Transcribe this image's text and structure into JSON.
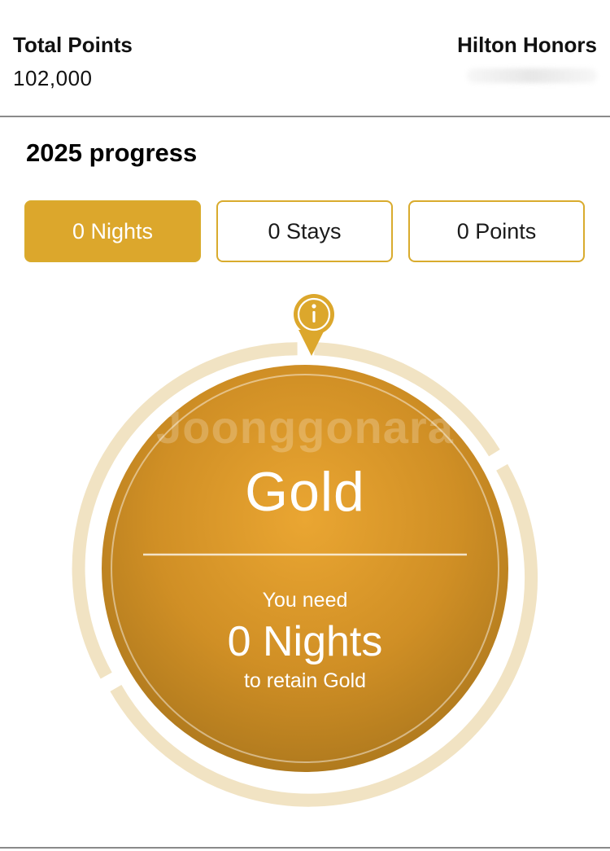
{
  "header": {
    "total_points_label": "Total Points",
    "total_points_value": "102,000",
    "program_name": "Hilton Honors"
  },
  "progress": {
    "title": "2025 progress",
    "tabs": [
      {
        "label": "0 Nights",
        "active": true
      },
      {
        "label": "0 Stays",
        "active": false
      },
      {
        "label": "0 Points",
        "active": false
      }
    ],
    "progress_fraction": 0
  },
  "medal": {
    "tier": "Gold",
    "need_label": "You need",
    "need_value": "0 Nights",
    "retain_label": "to retain Gold",
    "watermark": "Joonggonara"
  },
  "icons": {
    "info_marker": "info-icon"
  },
  "colors": {
    "accent_gold": "#dca72c",
    "ring_track": "#f1e2c0",
    "medal_center": "#e8a530",
    "medal_edge": "#b57d1f"
  }
}
